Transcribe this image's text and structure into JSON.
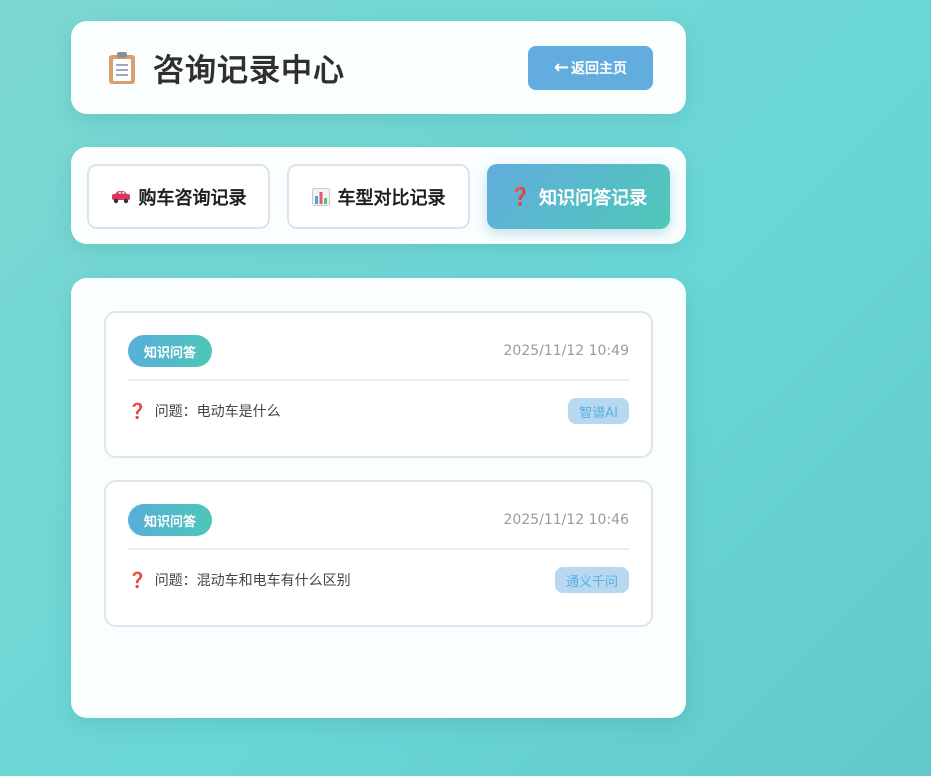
{
  "header": {
    "icon": "clipboard-icon",
    "title": "咨询记录中心",
    "back_button_label": "返回主页",
    "back_arrow": "←"
  },
  "tabs": [
    {
      "icon": "car-icon",
      "label": "购车咨询记录",
      "active": false
    },
    {
      "icon": "bar-chart-icon",
      "label": "车型对比记录",
      "active": false
    },
    {
      "icon": "question-icon",
      "label": "知识问答记录",
      "active": true
    }
  ],
  "records": [
    {
      "badge": "知识问答",
      "time": "2025/11/12 10:49",
      "question_icon": "❓",
      "question": "问题：电动车是什么",
      "model": "智谱AI"
    },
    {
      "badge": "知识问答",
      "time": "2025/11/12 10:46",
      "question_icon": "❓",
      "question": "问题：混动车和电车有什么区别",
      "model": "通义千问"
    }
  ],
  "colors": {
    "accent_blue": "#62acde",
    "accent_teal": "#4ec9b7",
    "question_red": "#e0355a"
  }
}
